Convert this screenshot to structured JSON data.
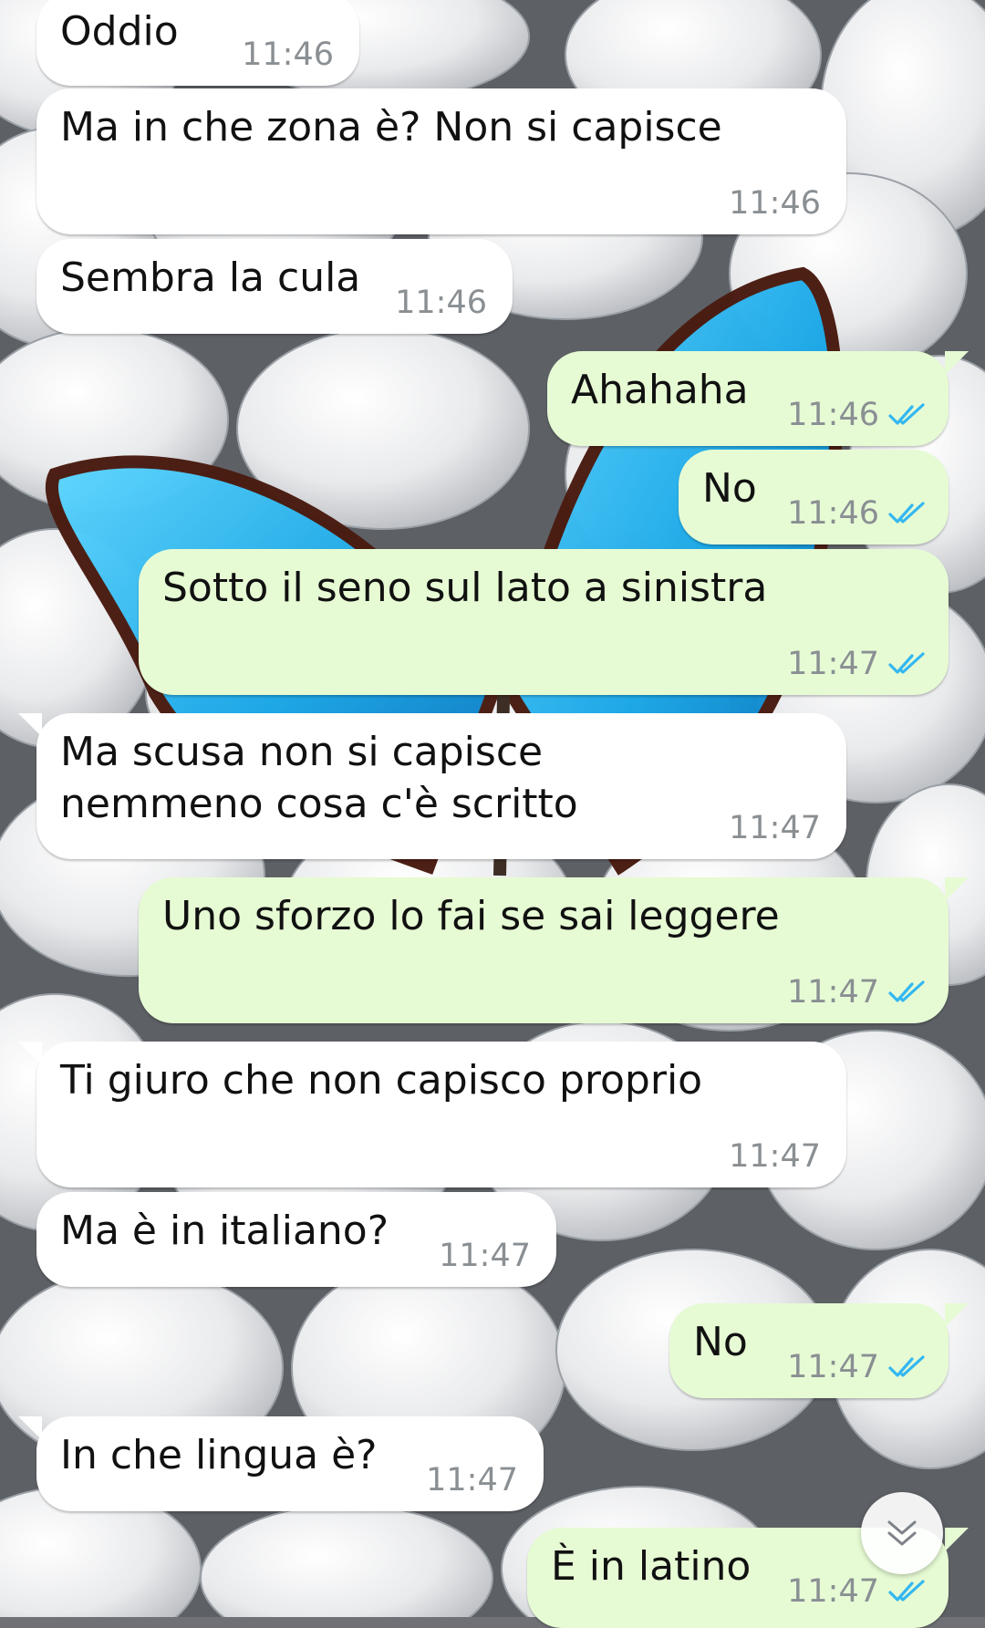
{
  "colors": {
    "incoming_bubble": "#ffffff",
    "outgoing_bubble": "#e6fbd4",
    "read_ticks": "#34b7f1",
    "time_text": "#8a8f93"
  },
  "messages": [
    {
      "dir": "in",
      "text": "Oddio",
      "time": "11:46"
    },
    {
      "dir": "in",
      "text": "Ma in che zona è? Non si capisce",
      "time": "11:46"
    },
    {
      "dir": "in",
      "text": "Sembra la cula",
      "time": "11:46"
    },
    {
      "dir": "out",
      "text": "Ahahaha",
      "time": "11:46",
      "status": "read"
    },
    {
      "dir": "out",
      "text": "No",
      "time": "11:46",
      "status": "read"
    },
    {
      "dir": "out",
      "text": "Sotto il seno sul lato a sinistra",
      "time": "11:47",
      "status": "read"
    },
    {
      "dir": "in",
      "text": "Ma scusa non si capisce nemmeno cosa c'è scritto",
      "time": "11:47"
    },
    {
      "dir": "out",
      "text": "Uno sforzo lo fai se sai leggere",
      "time": "11:47",
      "status": "read"
    },
    {
      "dir": "in",
      "text": "Ti giuro che non capisco proprio",
      "time": "11:47"
    },
    {
      "dir": "in",
      "text": "Ma è in italiano?",
      "time": "11:47"
    },
    {
      "dir": "out",
      "text": "No",
      "time": "11:47",
      "status": "read"
    },
    {
      "dir": "in",
      "text": "In che lingua è?",
      "time": "11:47"
    },
    {
      "dir": "out",
      "text": "È in latino",
      "time": "11:47",
      "status": "read"
    }
  ],
  "scroll_button": {
    "icon": "chevron-double-down-icon"
  },
  "background": {
    "wallpaper": "white pebbles with blue butterfly"
  }
}
